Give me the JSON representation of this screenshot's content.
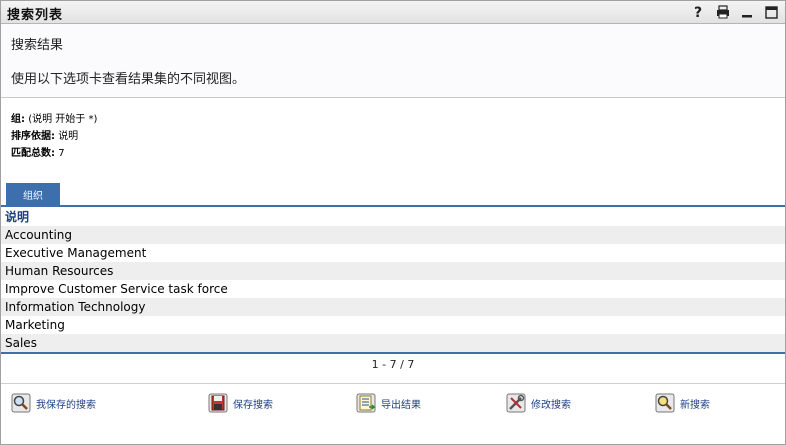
{
  "window": {
    "title": "搜索列表"
  },
  "header": {
    "heading": "搜索结果",
    "description": "使用以下选项卡查看结果集的不同视图。"
  },
  "criteria": {
    "group_label": "组:",
    "group_value": "(说明 开始于 *)",
    "sort_label": "排序依据:",
    "sort_value": "说明",
    "count_label": "匹配总数:",
    "count_value": "7"
  },
  "tabs": [
    {
      "label": "组织"
    }
  ],
  "table": {
    "column": "说明",
    "rows": [
      "Accounting",
      "Executive Management",
      "Human Resources",
      "Improve Customer Service task force",
      "Information Technology",
      "Marketing",
      "Sales"
    ]
  },
  "pager": "1 - 7 / 7",
  "actions": {
    "my_saved": "我保存的搜索",
    "save": "保存搜索",
    "export": "导出结果",
    "modify": "修改搜索",
    "new": "新搜索"
  },
  "colors": {
    "accent": "#3d6fae",
    "link": "#1c3f86"
  }
}
